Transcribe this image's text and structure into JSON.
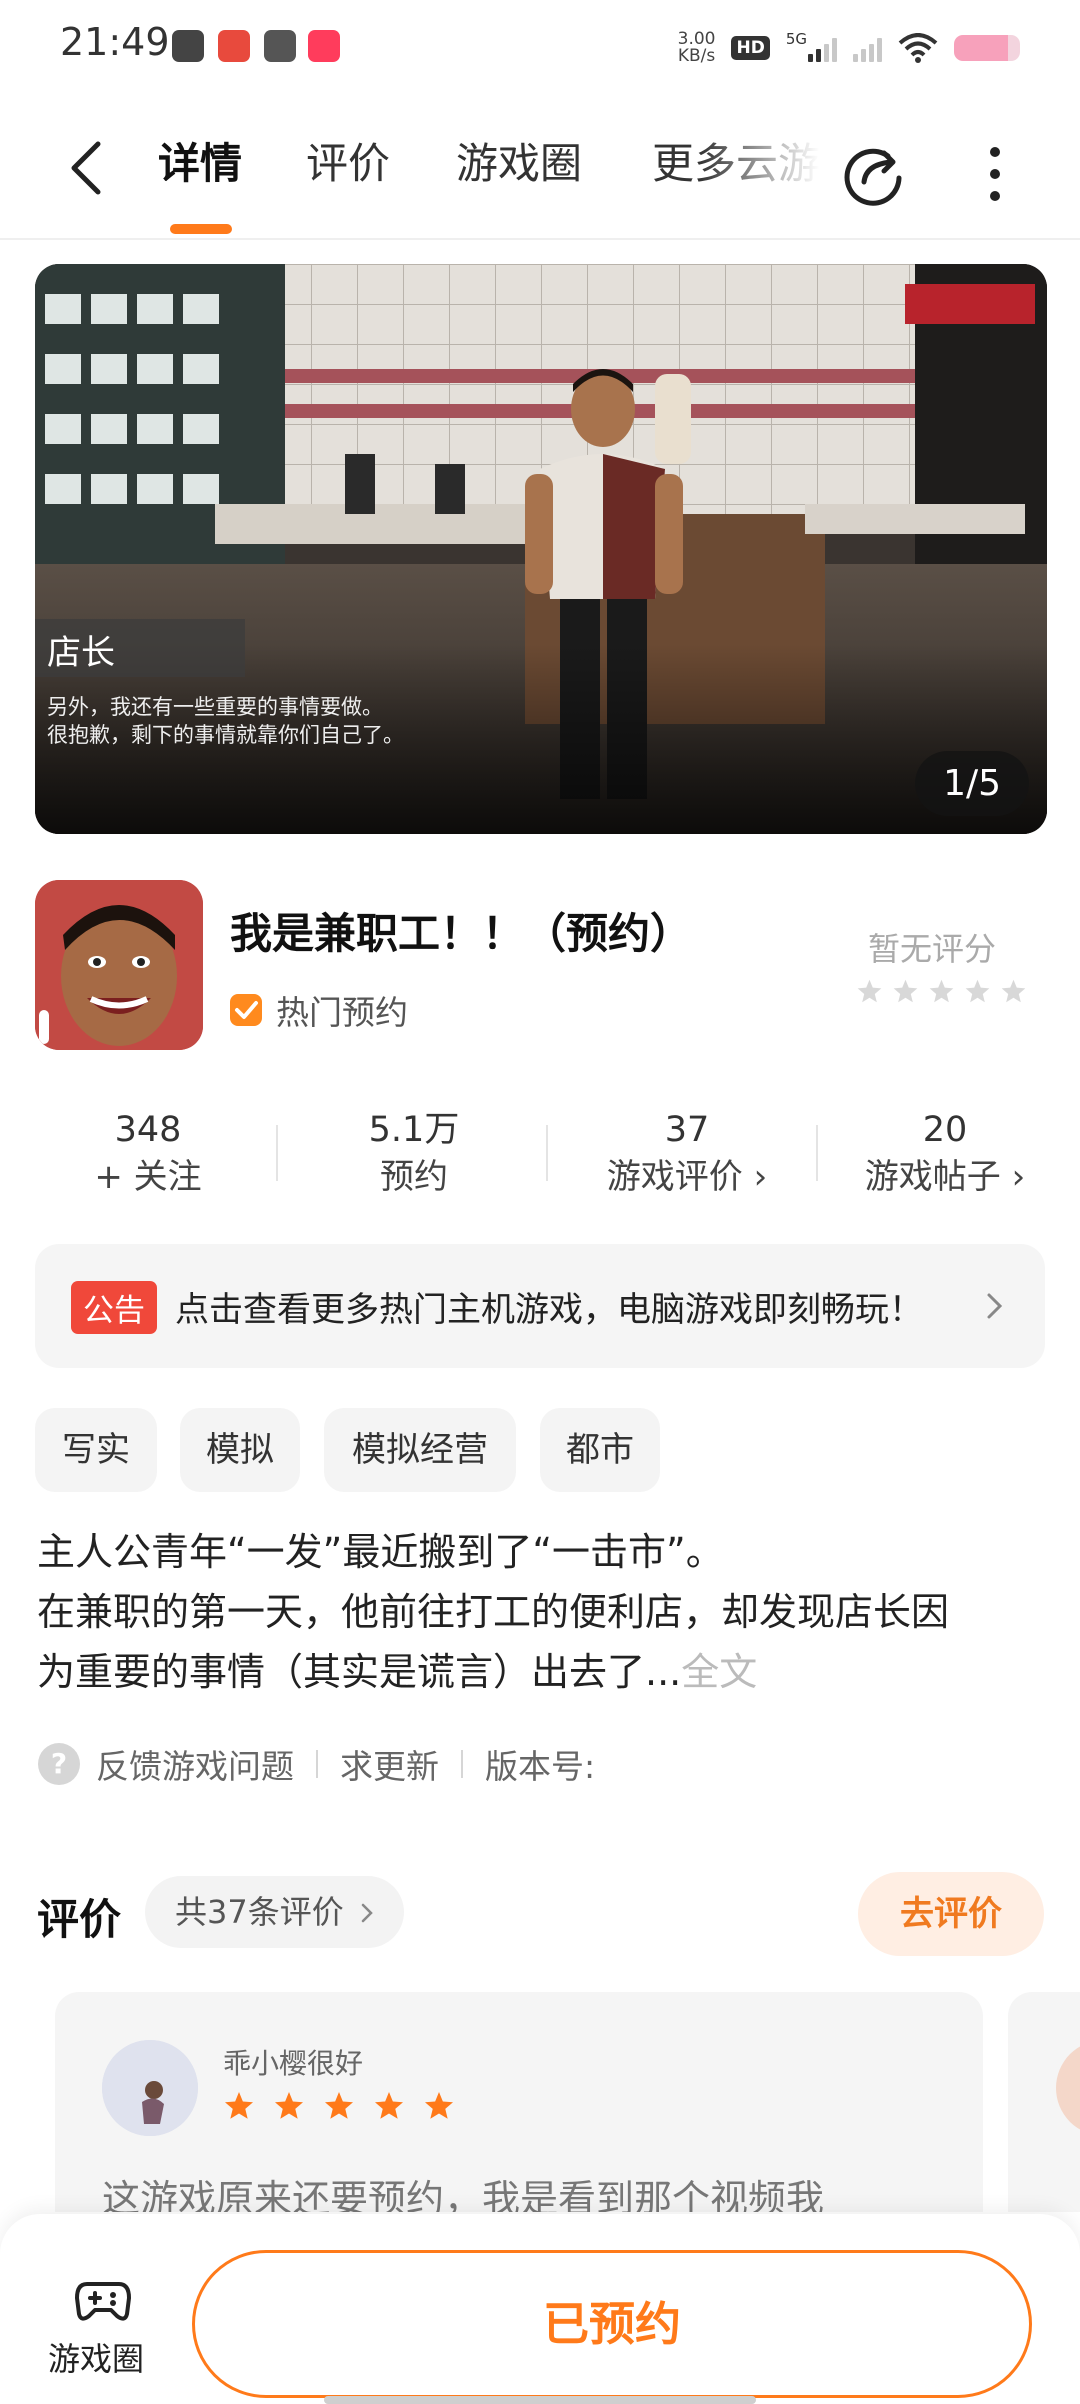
{
  "status_bar": {
    "time": "21:49",
    "net_speed_value": "3.00",
    "net_speed_unit": "KB/s",
    "hd_label": "HD",
    "network_label": "5G"
  },
  "nav": {
    "tabs": [
      "详情",
      "评价",
      "游戏圈",
      "更多云游"
    ],
    "active_tab": "详情"
  },
  "banner": {
    "counter": "1/5"
  },
  "game": {
    "title": "我是兼职工！！（预约）",
    "badge": "热门预约",
    "rating_text": "暂无评分",
    "rating_stars": 5
  },
  "stats": [
    {
      "value": "348",
      "label": "+ 关注"
    },
    {
      "value": "5.1万",
      "label": "预约"
    },
    {
      "value": "37",
      "label": "游戏评价 ›"
    },
    {
      "value": "20",
      "label": "游戏帖子 ›"
    }
  ],
  "notice": {
    "tag": "公告",
    "text": "点击查看更多热门主机游戏，电脑游戏即刻畅玩！"
  },
  "tags": [
    "写实",
    "模拟",
    "模拟经营",
    "都市"
  ],
  "description": {
    "line1": "主人公青年“一发”最近搬到了“一击市”。",
    "line2": "在兼职的第一天，他前往打工的便利店，却发现店长因",
    "line3": "为重要的事情（其实是谎言）出去了...",
    "more": "全文"
  },
  "links": {
    "icon": "?",
    "feedback": "反馈游戏问题",
    "update": "求更新",
    "version": "版本号:"
  },
  "reviews": {
    "title": "评价",
    "count": "共37条评价",
    "go": "去评价",
    "items": [
      {
        "user": "乖小樱很好",
        "stars": 5,
        "text": "这游戏原来还要预约，我是看到那个视频我"
      }
    ]
  },
  "bottom_bar": {
    "circle_label": "游戏圈",
    "reserve_button": "已预约"
  },
  "colors": {
    "accent": "#ff7a1a",
    "notice_tag": "#f0483a",
    "hot_badge": "#ff8a1e",
    "review_star": "#ff7a1a",
    "empty_star": "#d8d8d8"
  }
}
